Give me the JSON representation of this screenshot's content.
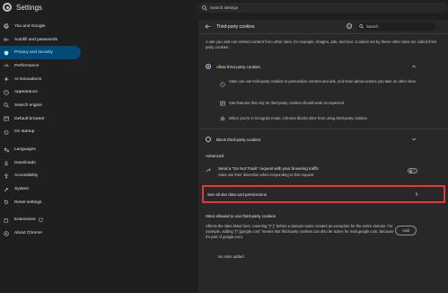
{
  "app": {
    "title": "Settings",
    "search_placeholder": "Search settings"
  },
  "sidebar": {
    "items": [
      {
        "label": "You and Google",
        "icon": "google-icon"
      },
      {
        "label": "Autofill and passwords",
        "icon": "key-icon"
      },
      {
        "label": "Privacy and security",
        "icon": "shield-icon",
        "active": true
      },
      {
        "label": "Performance",
        "icon": "speedometer-icon"
      },
      {
        "label": "AI innovations",
        "icon": "sparkle-icon"
      },
      {
        "label": "Appearance",
        "icon": "palette-icon"
      },
      {
        "label": "Search engine",
        "icon": "search-icon"
      },
      {
        "label": "Default browser",
        "icon": "browser-icon"
      },
      {
        "label": "On startup",
        "icon": "power-icon"
      },
      {
        "label": "Languages",
        "icon": "translate-icon"
      },
      {
        "label": "Downloads",
        "icon": "download-icon"
      },
      {
        "label": "Accessibility",
        "icon": "accessibility-icon"
      },
      {
        "label": "System",
        "icon": "wrench-icon"
      },
      {
        "label": "Reset settings",
        "icon": "reset-icon"
      },
      {
        "label": "Extensions",
        "icon": "puzzle-icon"
      },
      {
        "label": "About Chrome",
        "icon": "chrome-icon"
      }
    ]
  },
  "panel": {
    "title": "Third-party cookies",
    "search_placeholder": "Search",
    "description": "A site you visit can embed content from other sites, for example, images, ads, and text. Cookies set by these other sites are called third-party cookies.",
    "allow_label": "Allow third-party cookies",
    "allow_sub": [
      "Sites can use third-party cookies to personalize content and ads, and learn about actions you take on other sites",
      "Site features that rely on third-party cookies should work as expected",
      "When you're in Incognito mode, Chrome blocks sites from using third-party cookies"
    ],
    "block_label": "Block third-party cookies",
    "advanced_label": "Advanced",
    "dnt_title": "Send a \"Do Not Track\" request with your browsing traffic",
    "dnt_sub": "Sites use their discretion when responding to this request",
    "see_all_label": "See all site data and permissions",
    "allowed_title": "Sites allowed to use third-party cookies",
    "allowed_desc": "Affects the sites listed here. Inserting \"[*.]\" before a domain name creates an exception for the entire domain. For example, adding \"[*.]google.com\" means that third-party cookies can also be active for mail.google.com, because it's part of google.com.",
    "add_label": "Add",
    "no_sites": "No sites added"
  },
  "colors": {
    "background": "#1f1f1f",
    "panel": "#282828",
    "active_nav": "#004a77",
    "accent": "#a8c7fa",
    "highlight_border": "#e53935"
  }
}
